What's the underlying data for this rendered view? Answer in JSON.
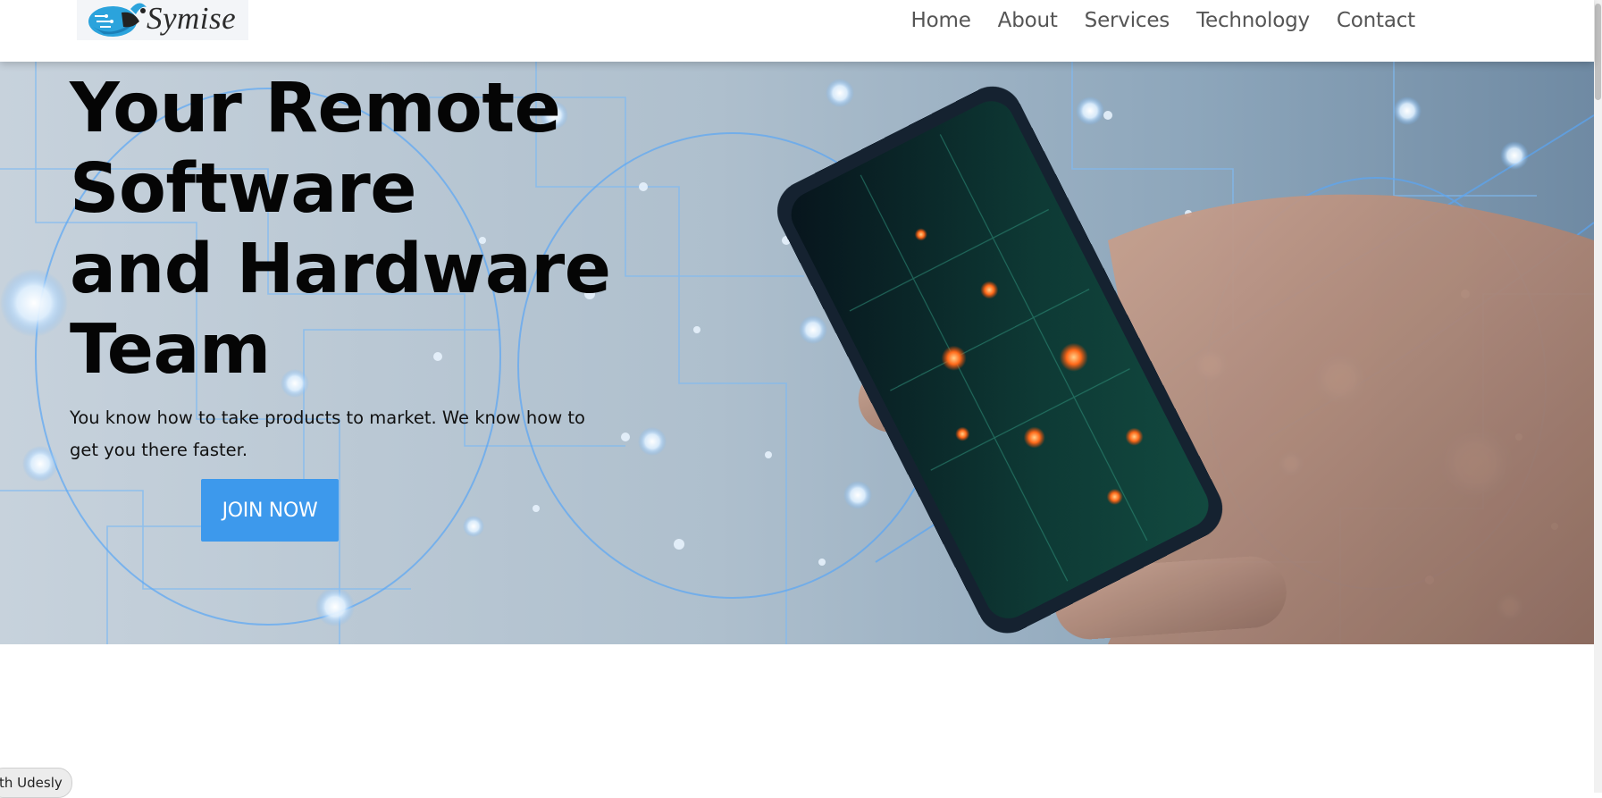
{
  "brand": {
    "name": "Symise",
    "logo_icon": "bird-circuit-logo-icon",
    "logo_color": "#2ba3dc"
  },
  "nav": {
    "items": [
      "Home",
      "About",
      "Services",
      "Technology",
      "Contact"
    ]
  },
  "hero": {
    "title_lines": [
      "Your Remote",
      "Software",
      "and Hardware",
      "Team"
    ],
    "subtitle": "You know how to take products to market. We know how to get you there faster.",
    "cta_label": "JOIN NOW",
    "cta_color": "#3d99ec",
    "image_description_icon": "hand-holding-smartphone-network-image"
  },
  "badge": {
    "label": "th Udesly"
  }
}
